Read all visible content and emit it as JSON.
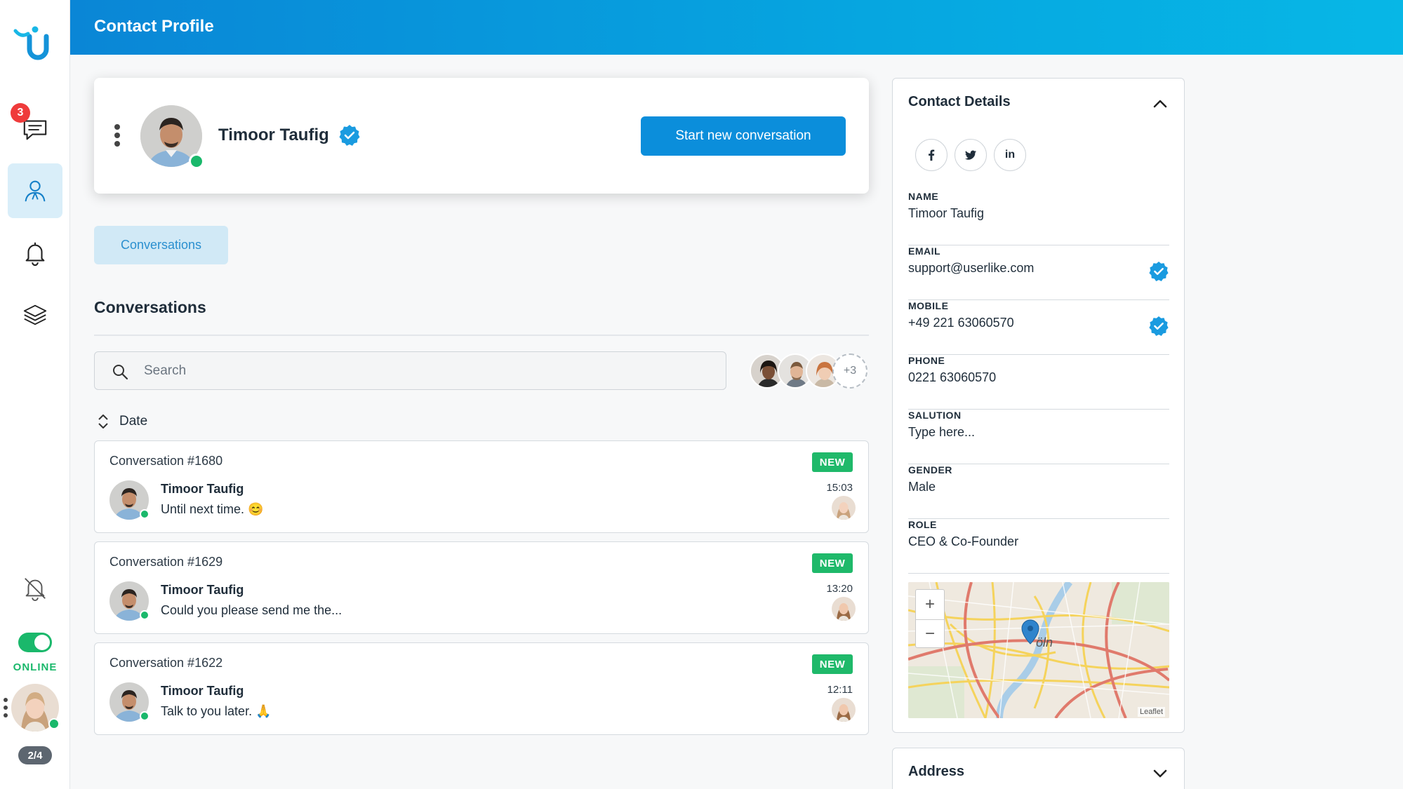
{
  "header": {
    "title": "Contact Profile"
  },
  "sidebar": {
    "unread_badge": "3",
    "status_label": "ONLINE",
    "page_count": "2/4",
    "items": [
      {
        "name": "chat-icon"
      },
      {
        "name": "contacts-icon"
      },
      {
        "name": "bell-icon"
      },
      {
        "name": "layers-icon"
      },
      {
        "name": "bell-off-icon"
      }
    ]
  },
  "profile": {
    "name": "Timoor Taufig",
    "start_button": "Start new conversation"
  },
  "tabs": {
    "conversations_tab": "Conversations"
  },
  "conversations": {
    "title": "Conversations",
    "search_placeholder": "Search",
    "participants_more": "+3",
    "sort_label": "Date",
    "items": [
      {
        "title": "Conversation #1680",
        "badge": "NEW",
        "name": "Timoor Taufig",
        "message": "Until next time. 😊",
        "time": "15:03"
      },
      {
        "title": "Conversation #1629",
        "badge": "NEW",
        "name": "Timoor Taufig",
        "message": "Could you please send me the...",
        "time": "13:20"
      },
      {
        "title": "Conversation #1622",
        "badge": "NEW",
        "name": "Timoor Taufig",
        "message": "Talk to you later. 🙏",
        "time": "12:11"
      }
    ]
  },
  "contact_details": {
    "title": "Contact Details",
    "social": [
      "f",
      "t",
      "in"
    ],
    "fields": {
      "name": {
        "label": "NAME",
        "value": "Timoor Taufig"
      },
      "email": {
        "label": "EMAIL",
        "value": "support@userlike.com"
      },
      "mobile": {
        "label": "MOBILE",
        "value": "+49 221 63060570"
      },
      "phone": {
        "label": "PHONE",
        "value": "0221 63060570"
      },
      "salution": {
        "label": "SALUTION",
        "value": "Type here..."
      },
      "gender": {
        "label": "GENDER",
        "value": "Male"
      },
      "role": {
        "label": "ROLE",
        "value": "CEO & Co-Founder"
      }
    },
    "map": {
      "city_label": "öln",
      "attribution": "Leaflet",
      "zoom_in": "+",
      "zoom_out": "−"
    }
  },
  "address": {
    "title": "Address"
  },
  "colors": {
    "accent": "#0b8edb",
    "online": "#1ab86b",
    "badge_red": "#ef3b3b",
    "new_badge": "#1fb96a"
  }
}
